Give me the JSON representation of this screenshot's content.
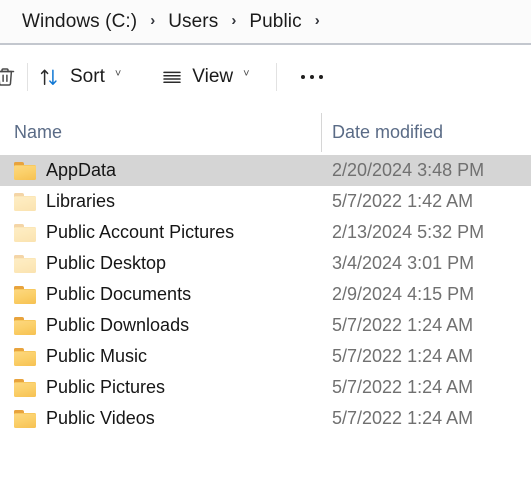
{
  "window": {
    "app": "File Explorer",
    "location": "Windows (C:) > Users > Public"
  },
  "breadcrumb": {
    "separator": "›",
    "items": [
      {
        "label": "Windows (C:)"
      },
      {
        "label": "Users"
      },
      {
        "label": "Public"
      }
    ],
    "trailing_separator": "›"
  },
  "toolbar": {
    "delete_icon": "trash-icon",
    "sort": {
      "label": "Sort",
      "icon": "sort-arrows-icon",
      "chevron": "˅",
      "arrow_up_color": "#2b2b2b",
      "arrow_down_color": "#0f77d4"
    },
    "view": {
      "label": "View",
      "icon": "list-lines-icon",
      "chevron": "˅"
    },
    "more": {
      "label": "See more",
      "icon": "ellipsis-icon"
    }
  },
  "columns": {
    "name": "Name",
    "date_modified": "Date modified",
    "header_color": "#5a6b86"
  },
  "selection": {
    "selected_index": 0,
    "highlight_color": "#d5d5d5"
  },
  "files": [
    {
      "name": "AppData",
      "date": "2/20/2024 3:48 PM",
      "icon": "folder-icon",
      "dimmed": false,
      "selected": true
    },
    {
      "name": "Libraries",
      "date": "5/7/2022 1:42 AM",
      "icon": "folder-icon",
      "dimmed": true,
      "selected": false
    },
    {
      "name": "Public Account Pictures",
      "date": "2/13/2024 5:32 PM",
      "icon": "folder-icon",
      "dimmed": true,
      "selected": false
    },
    {
      "name": "Public Desktop",
      "date": "3/4/2024 3:01 PM",
      "icon": "folder-icon",
      "dimmed": true,
      "selected": false
    },
    {
      "name": "Public Documents",
      "date": "2/9/2024 4:15 PM",
      "icon": "folder-icon",
      "dimmed": false,
      "selected": false
    },
    {
      "name": "Public Downloads",
      "date": "5/7/2022 1:24 AM",
      "icon": "folder-icon",
      "dimmed": false,
      "selected": false
    },
    {
      "name": "Public Music",
      "date": "5/7/2022 1:24 AM",
      "icon": "folder-icon",
      "dimmed": false,
      "selected": false
    },
    {
      "name": "Public Pictures",
      "date": "5/7/2022 1:24 AM",
      "icon": "folder-icon",
      "dimmed": false,
      "selected": false
    },
    {
      "name": "Public Videos",
      "date": "5/7/2022 1:24 AM",
      "icon": "folder-icon",
      "dimmed": false,
      "selected": false
    }
  ],
  "colors": {
    "breadcrumb_bg": "#fbfbfb",
    "breadcrumb_divider": "#c3c7ce",
    "body_bg": "#ffffff",
    "folder_yellow": "#fbd06a",
    "folder_tab": "#e8a33d",
    "text_primary": "#151515",
    "text_secondary": "#707070",
    "accent_blue": "#0f77d4"
  }
}
